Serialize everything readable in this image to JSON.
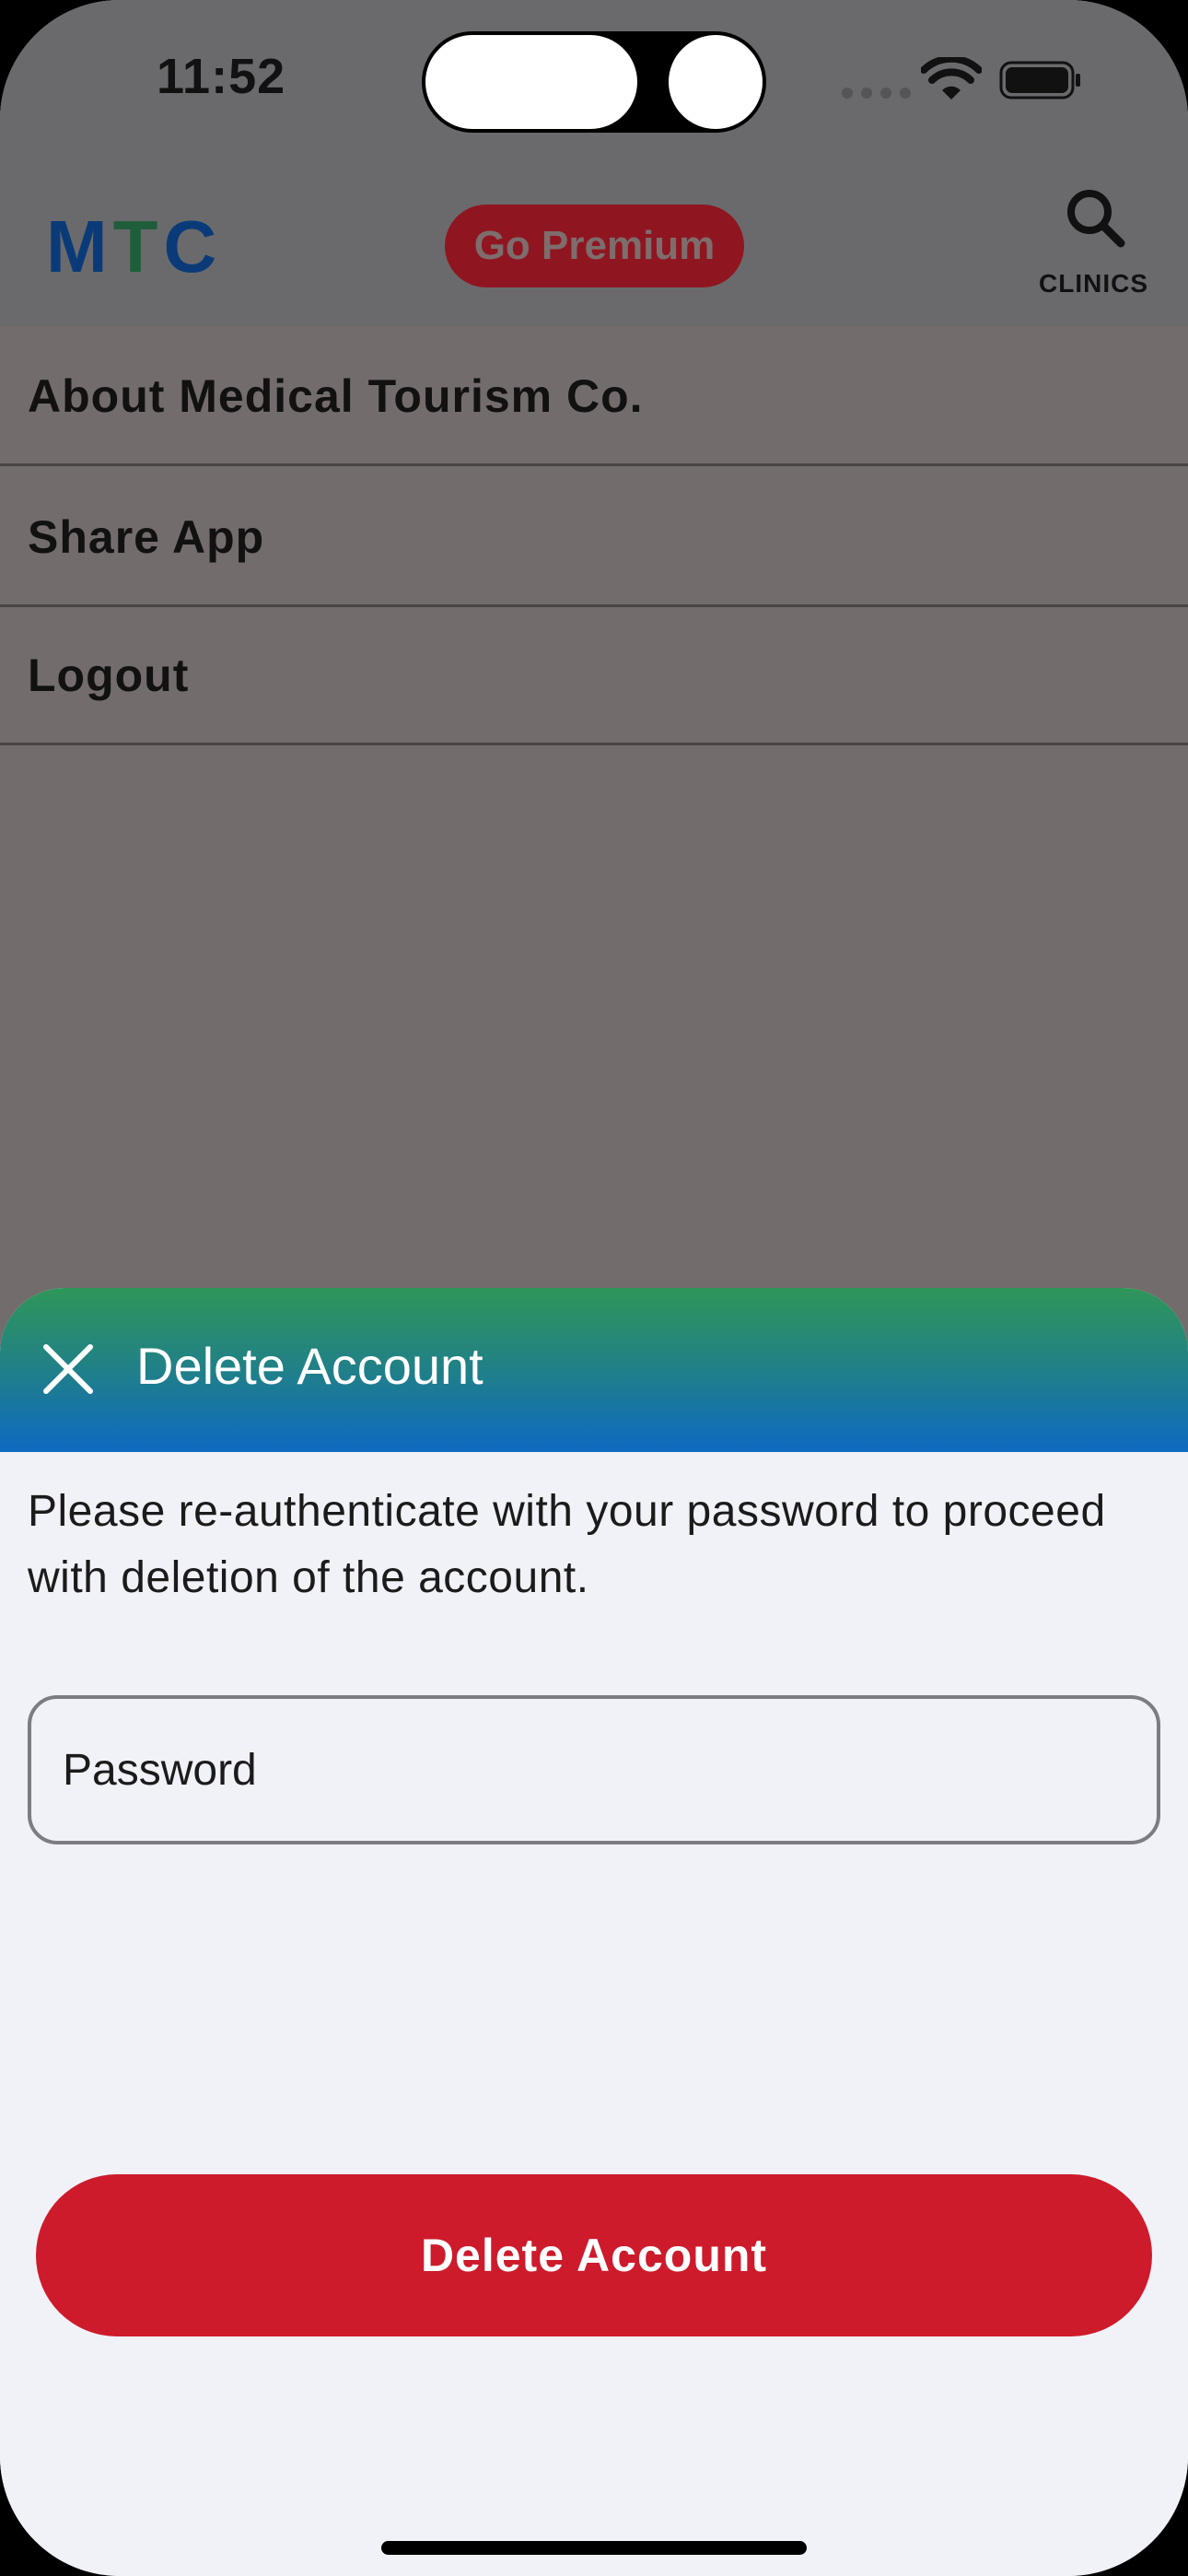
{
  "status_bar": {
    "time": "11:52"
  },
  "header": {
    "logo_letters": [
      "M",
      "T",
      "C"
    ],
    "premium_label": "Go Premium",
    "clinics_label": "CLINICS"
  },
  "menu": {
    "items": [
      {
        "label": "About Medical Tourism Co."
      },
      {
        "label": "Share App"
      },
      {
        "label": "Logout"
      }
    ]
  },
  "sheet": {
    "title": "Delete Account",
    "message": "Please re-authenticate with your password to proceed with deletion of the account.",
    "password_placeholder": "Password",
    "delete_label": "Delete Account"
  },
  "colors": {
    "delete_button": "#cd1b2c",
    "header_gradient_top": "#2f9659",
    "header_gradient_bottom": "#0f69c2",
    "premium_button": "#8f1620",
    "logo_blue": "#0a3b78",
    "logo_green": "#1f5e3a"
  },
  "icons": {
    "search": "search-icon",
    "close": "close-icon",
    "wifi": "wifi-icon",
    "battery": "battery-icon"
  }
}
